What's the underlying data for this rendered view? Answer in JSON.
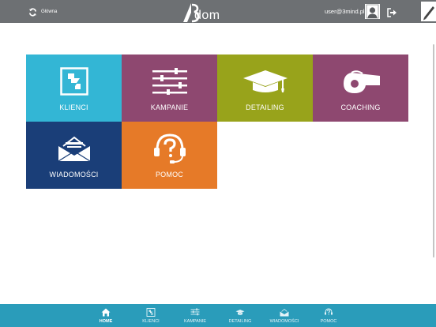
{
  "header": {
    "home_label": "Główna",
    "logo_text": "dom",
    "user_email": "user@3mind.pl"
  },
  "tiles": [
    {
      "label": "KLIENCI",
      "icon": "clients-icon",
      "color": "#33b6d5"
    },
    {
      "label": "KAMPANIE",
      "icon": "sliders-icon",
      "color": "#8e4870"
    },
    {
      "label": "DETAILING",
      "icon": "graduation-cap-icon",
      "color": "#98a31b"
    },
    {
      "label": "COACHING",
      "icon": "whistle-icon",
      "color": "#8e4870"
    },
    {
      "label": "WIADOMOŚCI",
      "icon": "envelope-icon",
      "color": "#1a3e78"
    },
    {
      "label": "POMOC",
      "icon": "help-headset-icon",
      "color": "#e67a28"
    }
  ],
  "bottom_nav": {
    "active": "HOME",
    "items": [
      {
        "label": "HOME",
        "icon": "home-icon"
      },
      {
        "label": "KLIENCI",
        "icon": "clients-icon"
      },
      {
        "label": "KAMPANIE",
        "icon": "sliders-icon"
      },
      {
        "label": "DETAILING",
        "icon": "graduation-cap-icon"
      },
      {
        "label": "WIADOMOŚCI",
        "icon": "envelope-icon"
      },
      {
        "label": "POMOC",
        "icon": "help-headset-icon"
      }
    ]
  },
  "colors": {
    "topbar": "#6d7073",
    "bottom_nav": "#2a9cba"
  }
}
